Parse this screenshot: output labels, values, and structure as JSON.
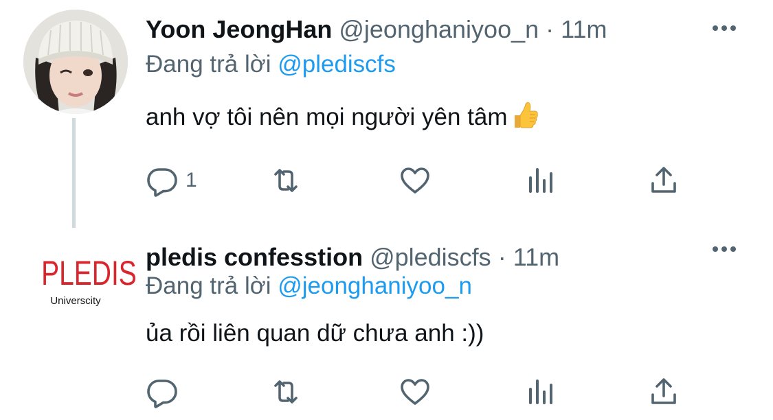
{
  "tweets": [
    {
      "author_name": "Yoon JeongHan",
      "handle": "@jeonghaniyoo_n",
      "separator": "·",
      "time": "11m",
      "replying_prefix": "Đang trả lời",
      "replying_to": "@plediscfs",
      "text": "anh vợ tôi nên mọi người yên tâm",
      "emoji": "thumbs-up",
      "reply_count": "1",
      "retweet_count": "",
      "like_count": ""
    },
    {
      "author_name": "pledis confesstion",
      "handle": "@plediscfs",
      "separator": "·",
      "time": "11m",
      "replying_prefix": "Đang trả lời",
      "replying_to": "@jeonghaniyoo_n",
      "text": "ủa rồi liên quan dữ chưa anh :))",
      "avatar_logo_text": "PLEDIS",
      "avatar_logo_subtext": "Universcity",
      "reply_count": "",
      "retweet_count": "",
      "like_count": ""
    }
  ],
  "colors": {
    "text_primary": "#0f1419",
    "text_secondary": "#536471",
    "link": "#1d9bf0",
    "thread_line": "#cfd9de",
    "pledis_red": "#d8262c"
  },
  "icons": [
    "reply-icon",
    "retweet-icon",
    "like-icon",
    "analytics-icon",
    "share-icon",
    "more-icon"
  ]
}
